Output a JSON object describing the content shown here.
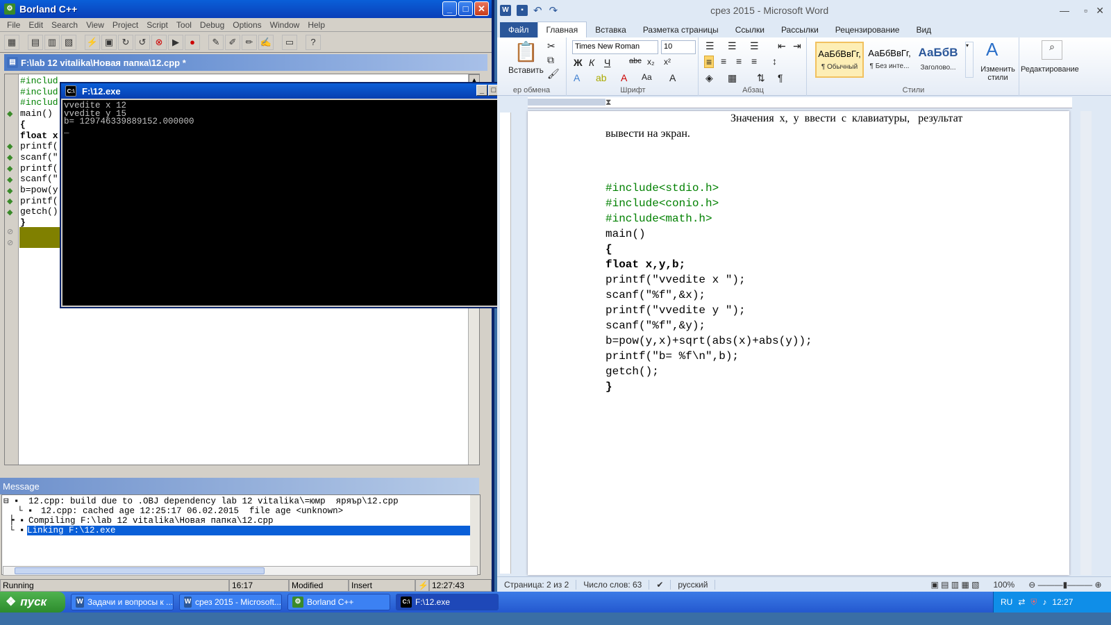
{
  "borland": {
    "title": "Borland C++",
    "menu": [
      "File",
      "Edit",
      "Search",
      "View",
      "Project",
      "Script",
      "Tool",
      "Debug",
      "Options",
      "Window",
      "Help"
    ],
    "editor_title": "F:\\lab 12 vitalika\\Новая папка\\12.cpp *",
    "code_lines": [
      "#includ",
      "#includ",
      "#includ",
      "main()",
      "{",
      "float x",
      "printf(",
      "scanf(\"",
      "printf(",
      "scanf(\"",
      "b=pow(y",
      "printf(",
      "getch()",
      "}"
    ],
    "message_title": "Message",
    "messages": [
      "12.cpp: build due to .OBJ dependency lab 12 vitalika\\=юмр  яряър\\12.cpp",
      "12.cpp: cached age 12:25:17 06.02.2015  file age <unknown>",
      "Compiling F:\\lab 12 vitalika\\Новая папка\\12.cpp",
      "Linking F:\\12.exe"
    ],
    "status": {
      "state": "Running",
      "pos": "16:17",
      "modified": "Modified",
      "mode": "Insert",
      "time": "12:27:43"
    }
  },
  "console": {
    "title": "F:\\12.exe",
    "output": "vvedite x 12\nvvedite y 15\nb= 129746339889152.000000\n_"
  },
  "word": {
    "title": "срез 2015  -  Microsoft Word",
    "tabs": [
      "Файл",
      "Главная",
      "Вставка",
      "Разметка страницы",
      "Ссылки",
      "Рассылки",
      "Рецензирование",
      "Вид"
    ],
    "font_name": "Times New Roman",
    "font_size": "10",
    "paste_label": "Вставить",
    "groups": {
      "clipboard": "ер обмена",
      "font": "Шрифт",
      "paragraph": "Абзац",
      "styles": "Стили"
    },
    "styles": [
      {
        "sample": "АаБбВвГг,",
        "name": "¶ Обычный"
      },
      {
        "sample": "АаБбВвГг,",
        "name": "¶ Без инте..."
      },
      {
        "sample": "АаБбВ",
        "name": "Заголово..."
      }
    ],
    "change_styles": "Изменить стили",
    "editing": "Редактирование",
    "doc_text_1": "Значения  x,  y  ввести  с  клавиатуры,   результат",
    "doc_text_2": "вывести на экран.",
    "doc_code": [
      "#include<stdio.h>",
      "#include<conio.h>",
      "#include<math.h>",
      "main()",
      "{",
      "float x,y,b;",
      "printf(\"vvedite x \");",
      "scanf(\"%f\",&x);",
      "printf(\"vvedite y \");",
      "scanf(\"%f\",&y);",
      "b=pow(y,x)+sqrt(abs(x)+abs(y));",
      "printf(\"b= %f\\n\",b);",
      "getch();",
      "}"
    ],
    "status": {
      "page": "Страница: 2 из 2",
      "words": "Число слов: 63",
      "lang": "русский",
      "zoom": "100%"
    }
  },
  "taskbar": {
    "start": "пуск",
    "tasks": [
      "Задачи и вопросы к ...",
      "срез 2015 - Microsoft...",
      "Borland C++",
      "F:\\12.exe"
    ],
    "lang": "RU",
    "clock": "12:27"
  }
}
